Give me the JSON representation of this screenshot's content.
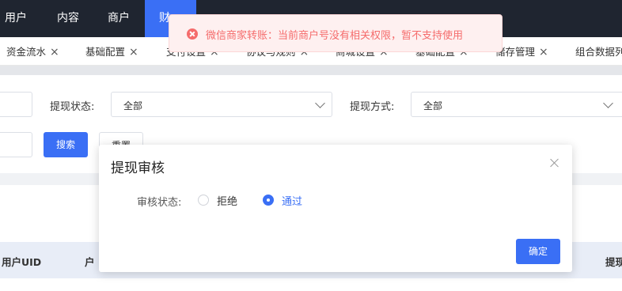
{
  "nav": {
    "items": [
      {
        "label": "用户"
      },
      {
        "label": "内容"
      },
      {
        "label": "商户"
      },
      {
        "label": "财"
      }
    ]
  },
  "tabs": [
    {
      "label": "资金流水"
    },
    {
      "label": "基础配置"
    },
    {
      "label": "支付设置"
    },
    {
      "label": "协议与规则"
    },
    {
      "label": "商城设置"
    },
    {
      "label": "基础配置"
    },
    {
      "label": "储存管理"
    },
    {
      "label": "组合数据列"
    }
  ],
  "filters": {
    "status_label": "提现状态:",
    "status_value": "全部",
    "method_label": "提现方式:",
    "method_value": "全部",
    "search_label": "搜索",
    "reset_label": "重置"
  },
  "table": {
    "headers": [
      "用户UID",
      "户",
      "提现"
    ]
  },
  "dialog": {
    "title": "提现审核",
    "field_label": "审核状态:",
    "options": [
      {
        "label": "拒绝",
        "checked": false
      },
      {
        "label": "通过",
        "checked": true
      }
    ],
    "confirm_label": "确定"
  },
  "toast": {
    "message": "微信商家转账：当前商户号没有相关权限，暂不支持使用"
  },
  "colors": {
    "primary": "#3a6ff5",
    "nav_bg": "#1f2530",
    "error": "#f56c6c"
  }
}
